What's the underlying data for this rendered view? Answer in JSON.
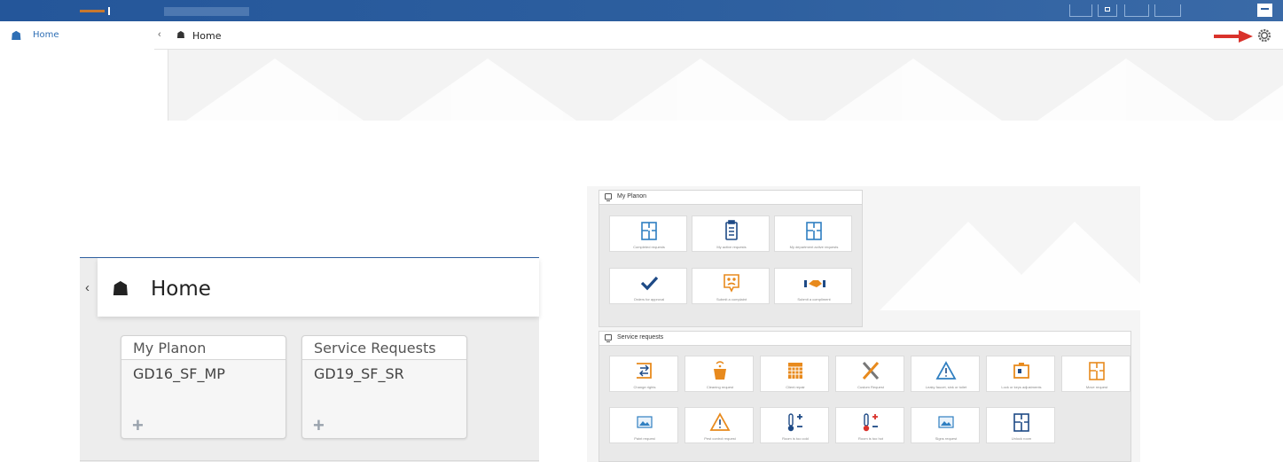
{
  "app": {
    "nav_home_label": "Home",
    "breadcrumb_label": "Home",
    "collapse_glyph": "‹"
  },
  "zoom": {
    "collapse_glyph": "‹",
    "title": "Home",
    "widgets": [
      {
        "title": "My Planon",
        "subtitle": "GD16_SF_MP",
        "add_glyph": "+"
      },
      {
        "title": "Service Requests",
        "subtitle": "GD19_SF_SR",
        "add_glyph": "+"
      }
    ]
  },
  "configured_home": {
    "my_planon": {
      "title": "My Planon",
      "tiles": [
        {
          "label": "Completed requests",
          "icon": "floorplan-icon"
        },
        {
          "label": "My active requests",
          "icon": "clipboard-icon"
        },
        {
          "label": "My department active requests",
          "icon": "floorplan-icon"
        },
        {
          "label": "Orders for approval",
          "icon": "checkmark-icon"
        },
        {
          "label": "Submit a complaint",
          "icon": "sad-face-icon"
        },
        {
          "label": "Submit a compliment",
          "icon": "handshake-icon"
        }
      ]
    },
    "service_requests": {
      "title": "Service requests",
      "tiles": [
        {
          "label": "Change rights",
          "icon": "exchange-icon"
        },
        {
          "label": "Cleaning request",
          "icon": "bucket-icon"
        },
        {
          "label": "Client repair",
          "icon": "calendar-icon"
        },
        {
          "label": "Custom Request",
          "icon": "tools-icon"
        },
        {
          "label": "Leaky faucet, sink or toilet",
          "icon": "warning-icon"
        },
        {
          "label": "Lock or keys adjustments",
          "icon": "id-card-icon"
        },
        {
          "label": "Move request",
          "icon": "floorplan-icon"
        },
        {
          "label": "Paint request",
          "icon": "picture-icon"
        },
        {
          "label": "Pest control request",
          "icon": "warning-icon"
        },
        {
          "label": "Room is too cold",
          "icon": "thermometer-cold-icon"
        },
        {
          "label": "Room is too hot",
          "icon": "thermometer-hot-icon"
        },
        {
          "label": "Signs request",
          "icon": "picture-icon"
        },
        {
          "label": "Unlock room",
          "icon": "floorplan-icon"
        }
      ]
    }
  },
  "colors": {
    "header_blue": "#2d5f9f",
    "accent_blue": "#2f7fc1",
    "accent_orange": "#e88a1d",
    "arrow_red": "#d9322b"
  }
}
